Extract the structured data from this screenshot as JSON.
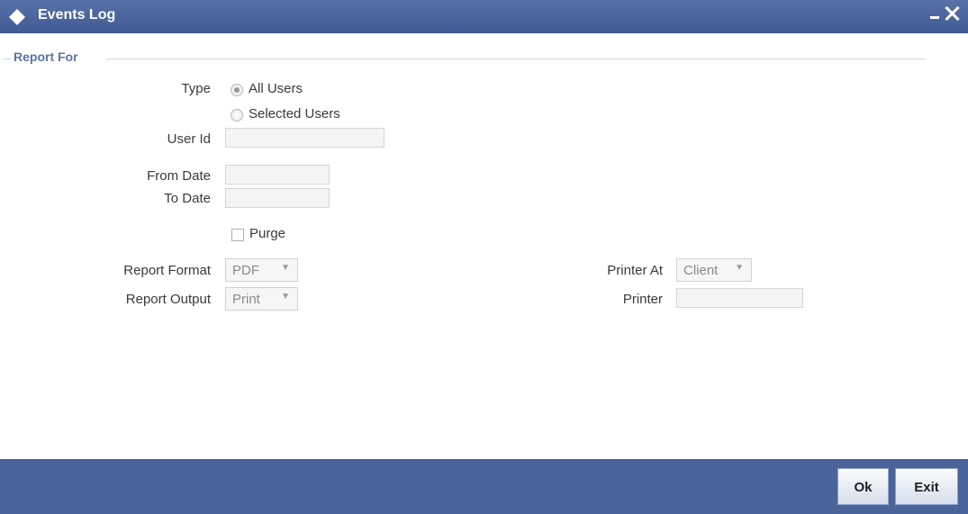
{
  "window": {
    "title": "Events Log"
  },
  "section": {
    "title": "Report For"
  },
  "form": {
    "type_label": "Type",
    "type_options": [
      {
        "label": "All Users",
        "checked": true
      },
      {
        "label": "Selected Users",
        "checked": false
      }
    ],
    "user_id_label": "User Id",
    "user_id_value": "",
    "from_date_label": "From Date",
    "from_date_value": "",
    "to_date_label": "To Date",
    "to_date_value": "",
    "purge_label": "Purge",
    "purge_checked": false,
    "report_format_label": "Report Format",
    "report_format_value": "PDF",
    "report_output_label": "Report Output",
    "report_output_value": "Print",
    "printer_at_label": "Printer At",
    "printer_at_value": "Client",
    "printer_label": "Printer",
    "printer_value": ""
  },
  "footer": {
    "ok_label": "Ok",
    "exit_label": "Exit"
  },
  "colors": {
    "titlebar": "#4a6398",
    "footer": "#4a6398",
    "section_title": "#5a73a8"
  }
}
